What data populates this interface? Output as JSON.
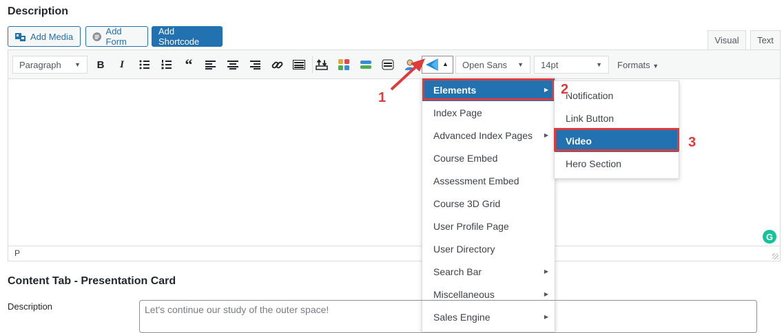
{
  "section_title": "Description",
  "buttons": {
    "add_media": "Add Media",
    "add_form": "Add Form",
    "add_shortcode": "Add Shortcode"
  },
  "tabs": {
    "visual": "Visual",
    "text": "Text"
  },
  "toolbar": {
    "paragraph": "Paragraph",
    "font": "Open Sans",
    "size": "14pt",
    "formats": "Formats"
  },
  "status_path": "P",
  "menu": {
    "items": [
      "Elements",
      "Index Page",
      "Advanced Index Pages",
      "Course Embed",
      "Assessment Embed",
      "Course 3D Grid",
      "User Profile Page",
      "User Directory",
      "Search Bar",
      "Miscellaneous",
      "Sales Engine"
    ],
    "submenu": [
      "Notification",
      "Link Button",
      "Video",
      "Hero Section"
    ]
  },
  "annotations": [
    "1",
    "2",
    "3"
  ],
  "content_tab": {
    "title": "Content Tab - Presentation Card",
    "label": "Description",
    "value": "Let's continue our study of the outer space!"
  },
  "colors": {
    "accent": "#2271b1",
    "annotation": "#e03b3b",
    "grammarly": "#15c39a"
  }
}
